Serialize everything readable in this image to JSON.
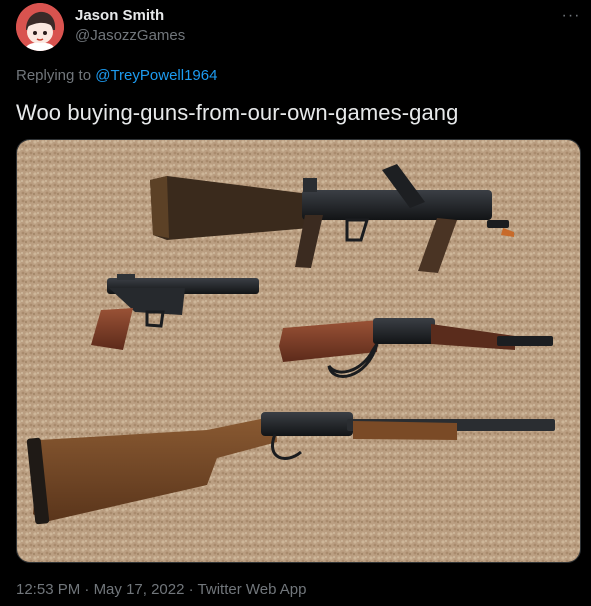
{
  "author": {
    "name": "Jason Smith",
    "handle": "@JasozzGames",
    "avatar_icon": "cartoon-face-avatar"
  },
  "menu": {
    "more_icon": "more-dots-icon",
    "label": "···"
  },
  "reply": {
    "prefix": "Replying to ",
    "mention": "@TreyPowell1964"
  },
  "tweet": {
    "text": "Woo buying-guns-from-our-own-games-gang"
  },
  "media": {
    "subject": "photo-of-four-firearms-on-carpet"
  },
  "meta": {
    "time": "12:53 PM",
    "sep1": " · ",
    "date": "May 17, 2022",
    "sep2": " · ",
    "source": "Twitter Web App"
  },
  "colors": {
    "background": "#000000",
    "text": "#e7e9ea",
    "secondary": "#71767b",
    "link": "#1d9bf0",
    "avatar_bg": "#d9534f",
    "carpet": "#c9ad8e"
  }
}
